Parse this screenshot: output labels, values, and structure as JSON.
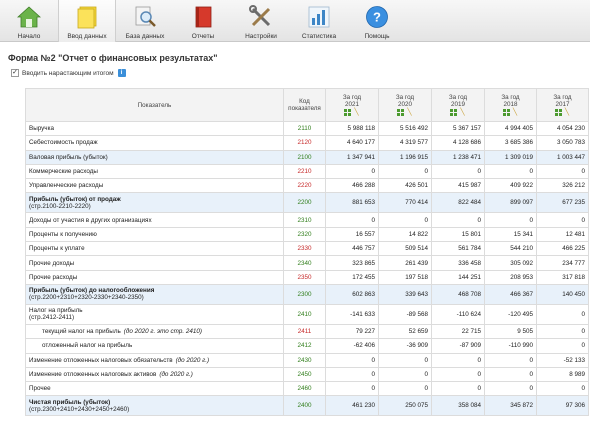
{
  "toolbar": {
    "items": [
      {
        "label": "Начало",
        "icon": "home-icon"
      },
      {
        "label": "Ввод данных",
        "icon": "notes-icon",
        "active": true
      },
      {
        "label": "База данных",
        "icon": "database-search-icon"
      },
      {
        "label": "Отчеты",
        "icon": "book-icon"
      },
      {
        "label": "Настройки",
        "icon": "tools-icon"
      },
      {
        "label": "Статистика",
        "icon": "bar-chart-icon"
      },
      {
        "label": "Помощь",
        "icon": "help-icon"
      }
    ]
  },
  "form_title": "Форма №2 \"Отчет о финансовых результатах\"",
  "cumulative": {
    "label": "Вводить нарастающим итогом",
    "checked": true,
    "check_glyph": "✓",
    "info_glyph": "i"
  },
  "table": {
    "header": {
      "name": "Показатель",
      "code": "Код показателя"
    },
    "years": [
      {
        "line1": "За год",
        "line2": "2021"
      },
      {
        "line1": "За год",
        "line2": "2020"
      },
      {
        "line1": "За год",
        "line2": "2019"
      },
      {
        "line1": "За год",
        "line2": "2018"
      },
      {
        "line1": "За год",
        "line2": "2017"
      }
    ],
    "rows": [
      {
        "name": "Выручка",
        "code": "2110",
        "code_color": "green",
        "values": [
          "5 988 118",
          "5 516 492",
          "5 367 157",
          "4 994 405",
          "4 054 230"
        ]
      },
      {
        "name": "Себестоимость продаж",
        "code": "2120",
        "code_color": "red",
        "values": [
          "4 640 177",
          "4 319 577",
          "4 128 686",
          "3 685 386",
          "3 050 783"
        ]
      },
      {
        "name": "Валовая прибыль (убыток)",
        "code": "2100",
        "code_color": "green",
        "highlight": true,
        "values": [
          "1 347 941",
          "1 196 915",
          "1 238 471",
          "1 309 019",
          "1 003 447"
        ]
      },
      {
        "name": "Коммерческие расходы",
        "code": "2210",
        "code_color": "red",
        "values": [
          "0",
          "0",
          "0",
          "0",
          "0"
        ]
      },
      {
        "name": "Управленческие расходы",
        "code": "2220",
        "code_color": "red",
        "values": [
          "466 288",
          "426 501",
          "415 987",
          "409 922",
          "326 212"
        ]
      },
      {
        "name": "Прибыль (убыток) от продаж",
        "sub": "(стр.2100-2210-2220)",
        "code": "2200",
        "code_color": "green",
        "highlight": true,
        "bold": true,
        "values": [
          "881 653",
          "770 414",
          "822 484",
          "899 097",
          "677 235"
        ]
      },
      {
        "name": "Доходы от участия в других организациях",
        "code": "2310",
        "code_color": "green",
        "values": [
          "0",
          "0",
          "0",
          "0",
          "0"
        ]
      },
      {
        "name": "Проценты к получению",
        "code": "2320",
        "code_color": "green",
        "values": [
          "16 557",
          "14 822",
          "15 801",
          "15 341",
          "12 481"
        ]
      },
      {
        "name": "Проценты к уплате",
        "code": "2330",
        "code_color": "red",
        "values": [
          "446 757",
          "509 514",
          "561 784",
          "544 210",
          "466 225"
        ]
      },
      {
        "name": "Прочие доходы",
        "code": "2340",
        "code_color": "green",
        "values": [
          "323 865",
          "261 439",
          "336 458",
          "305 092",
          "234 777"
        ]
      },
      {
        "name": "Прочие расходы",
        "code": "2350",
        "code_color": "red",
        "values": [
          "172 455",
          "197 518",
          "144 251",
          "208 953",
          "317 818"
        ]
      },
      {
        "name": "Прибыль (убыток) до налогообложения",
        "sub": "(стр.2200+2310+2320-2330+2340-2350)",
        "code": "2300",
        "code_color": "green",
        "highlight": true,
        "bold": true,
        "values": [
          "602 863",
          "339 643",
          "468 708",
          "466 367",
          "140 450"
        ]
      },
      {
        "name": "Налог на прибыль",
        "sub": "(стр.2412-2411)",
        "code": "2410",
        "code_color": "green",
        "values": [
          "-141 633",
          "-89 568",
          "-110 624",
          "-120 495",
          "0"
        ]
      },
      {
        "name": "текущий налог на прибыль",
        "note": "(до 2020 г. это стр. 2410)",
        "indent": true,
        "code": "2411",
        "code_color": "red",
        "values": [
          "79 227",
          "52 659",
          "22 715",
          "9 505",
          "0"
        ]
      },
      {
        "name": "отложенный налог на прибыль",
        "indent": true,
        "code": "2412",
        "code_color": "green",
        "values": [
          "-62 406",
          "-36 909",
          "-87 909",
          "-110 990",
          "0"
        ]
      },
      {
        "name": "Изменение отложенных налоговых обязательств",
        "note": "(до 2020 г.)",
        "code": "2430",
        "code_color": "green",
        "values": [
          "0",
          "0",
          "0",
          "0",
          "-52 133"
        ]
      },
      {
        "name": "Изменение отложенных налоговых активов",
        "note": "(до 2020 г.)",
        "code": "2450",
        "code_color": "green",
        "values": [
          "0",
          "0",
          "0",
          "0",
          "8 989"
        ]
      },
      {
        "name": "Прочее",
        "code": "2460",
        "code_color": "green",
        "values": [
          "0",
          "0",
          "0",
          "0",
          "0"
        ]
      },
      {
        "name": "Чистая прибыль (убыток)",
        "sub": "(стр.2300+2410+2430+2450+2460)",
        "code": "2400",
        "code_color": "green",
        "highlight": true,
        "bold": true,
        "values": [
          "461 230",
          "250 075",
          "358 084",
          "345 872",
          "97 306"
        ]
      }
    ]
  }
}
